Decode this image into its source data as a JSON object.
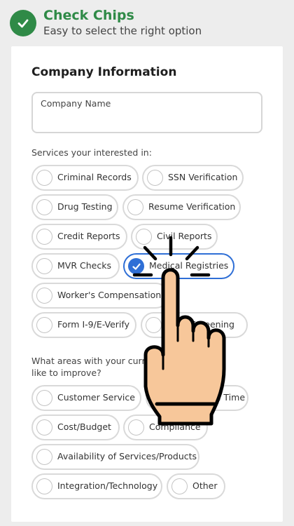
{
  "header": {
    "title": "Check Chips",
    "subtitle": "Easy to select the right option"
  },
  "form": {
    "section_title": "Company Information",
    "company_name_placeholder": "Company Name",
    "services_label": "Services your interested in:",
    "areas_label_line1": "What areas with your current",
    "areas_label_line2": "like to improve?"
  },
  "services": [
    {
      "label": "Criminal Records",
      "selected": false
    },
    {
      "label": "SSN Verification",
      "selected": false
    },
    {
      "label": "Drug Testing",
      "selected": false
    },
    {
      "label": "Resume Verification",
      "selected": false
    },
    {
      "label": "Credit Reports",
      "selected": false
    },
    {
      "label": "Civil Reports",
      "selected": false
    },
    {
      "label": "MVR Checks",
      "selected": false
    },
    {
      "label": "Medical Registries",
      "selected": true
    },
    {
      "label": "Worker's Compensation",
      "selected": false
    },
    {
      "label": "Form I-9/E-Verify",
      "selected": false
    },
    {
      "label": "Drug Screening",
      "selected": false
    }
  ],
  "areas": [
    {
      "label": "Customer Service",
      "selected": false
    },
    {
      "label": "Turnaround Time",
      "selected": false
    },
    {
      "label": "Cost/Budget",
      "selected": false
    },
    {
      "label": "Compliance",
      "selected": false
    },
    {
      "label": "Availability of Services/Products",
      "selected": false
    },
    {
      "label": "Integration/Technology",
      "selected": false
    },
    {
      "label": "Other",
      "selected": false
    }
  ],
  "colors": {
    "brand_green": "#2f8a47",
    "selected_blue": "#2f6fd6",
    "hand_skin": "#f7c79a"
  },
  "icons": {
    "header": "checkmark-icon",
    "selected_chip": "checkmark-icon",
    "pointer": "tapping-hand-icon"
  }
}
